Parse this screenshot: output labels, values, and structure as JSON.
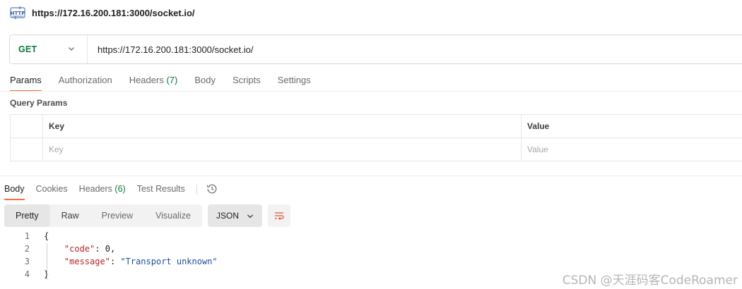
{
  "request": {
    "title": "https://172.16.200.181:3000/socket.io/",
    "icon": "http-request-icon",
    "method": "GET",
    "url": "https://172.16.200.181:3000/socket.io/"
  },
  "request_tabs": [
    {
      "label": "Params",
      "count": ""
    },
    {
      "label": "Authorization",
      "count": ""
    },
    {
      "label": "Headers",
      "count": "(7)"
    },
    {
      "label": "Body",
      "count": ""
    },
    {
      "label": "Scripts",
      "count": ""
    },
    {
      "label": "Settings",
      "count": ""
    }
  ],
  "query_params": {
    "title": "Query Params",
    "headers": {
      "key": "Key",
      "value": "Value"
    },
    "placeholders": {
      "key": "Key",
      "value": "Value"
    }
  },
  "response_tabs": [
    {
      "label": "Body",
      "count": ""
    },
    {
      "label": "Cookies",
      "count": ""
    },
    {
      "label": "Headers",
      "count": "(6)"
    },
    {
      "label": "Test Results",
      "count": ""
    }
  ],
  "view_modes": [
    "Pretty",
    "Raw",
    "Preview",
    "Visualize"
  ],
  "format": "JSON",
  "code": {
    "line_numbers": [
      "1",
      "2",
      "3",
      "4"
    ],
    "open_brace": "{",
    "close_brace": "}",
    "entries": [
      {
        "key": "\"code\"",
        "value": "0",
        "trail": ","
      },
      {
        "key": "\"message\"",
        "value": "\"Transport unknown\"",
        "trail": ""
      }
    ]
  },
  "watermark": "CSDN @天涯码客CodeRoamer",
  "colors": {
    "method": "#0b7a3b",
    "tab_underline": "#ff6c37",
    "json_key": "#b52828",
    "json_string": "#1e4f9c"
  }
}
